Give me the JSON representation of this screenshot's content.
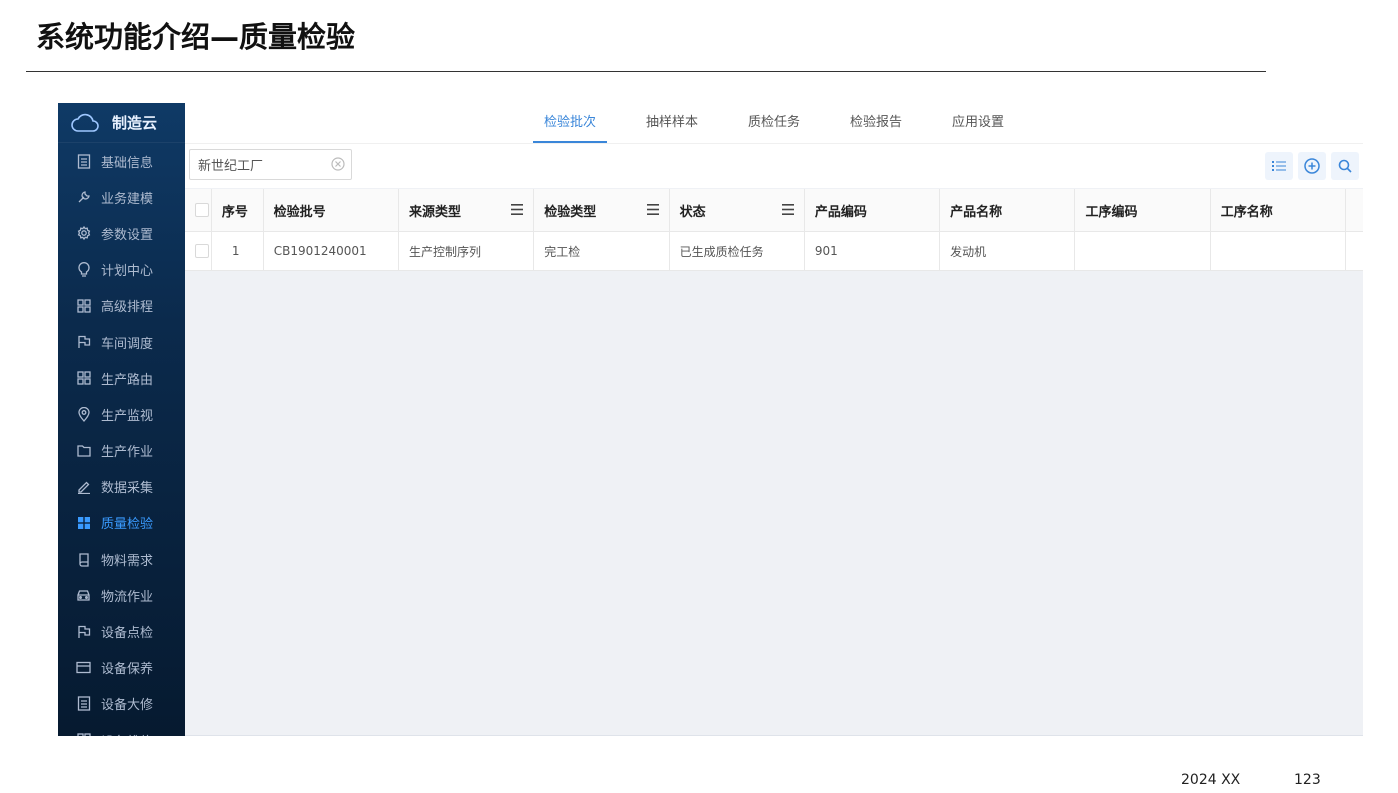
{
  "slide": {
    "title": "系统功能介绍—质量检验",
    "footer_date": "2024 XX",
    "footer_page": "123"
  },
  "sidebar": {
    "brand": "制造云",
    "items": [
      {
        "label": "基础信息",
        "icon": "document-icon"
      },
      {
        "label": "业务建模",
        "icon": "wrench-icon"
      },
      {
        "label": "参数设置",
        "icon": "gear-icon"
      },
      {
        "label": "计划中心",
        "icon": "bulb-icon"
      },
      {
        "label": "高级排程",
        "icon": "grid-icon"
      },
      {
        "label": "车间调度",
        "icon": "flag-icon"
      },
      {
        "label": "生产路由",
        "icon": "grid-icon"
      },
      {
        "label": "生产监视",
        "icon": "location-icon"
      },
      {
        "label": "生产作业",
        "icon": "folder-icon"
      },
      {
        "label": "数据采集",
        "icon": "pen-icon"
      },
      {
        "label": "质量检验",
        "icon": "tiles-icon",
        "active": true
      },
      {
        "label": "物料需求",
        "icon": "book-icon"
      },
      {
        "label": "物流作业",
        "icon": "car-icon"
      },
      {
        "label": "设备点检",
        "icon": "flag-icon"
      },
      {
        "label": "设备保养",
        "icon": "card-icon"
      },
      {
        "label": "设备大修",
        "icon": "document-icon"
      },
      {
        "label": "设备维修",
        "icon": "grid-icon"
      }
    ]
  },
  "tabs": [
    {
      "label": "检验批次",
      "active": true
    },
    {
      "label": "抽样样本"
    },
    {
      "label": "质检任务"
    },
    {
      "label": "检验报告"
    },
    {
      "label": "应用设置"
    }
  ],
  "toolbar": {
    "search_value": "新世纪工厂"
  },
  "table": {
    "headers": [
      "序号",
      "检验批号",
      "来源类型",
      "检验类型",
      "状态",
      "产品编码",
      "产品名称",
      "工序编码",
      "工序名称"
    ],
    "rows": [
      [
        "1",
        "CB1901240001",
        "生产控制序列",
        "完工检",
        "已生成质检任务",
        "901",
        "发动机",
        "",
        ""
      ]
    ]
  },
  "colors": {
    "accent": "#3a86d9",
    "sidebar_top": "#0f3a66",
    "sidebar_bottom": "#061a30",
    "content_bg": "#eff1f5"
  }
}
